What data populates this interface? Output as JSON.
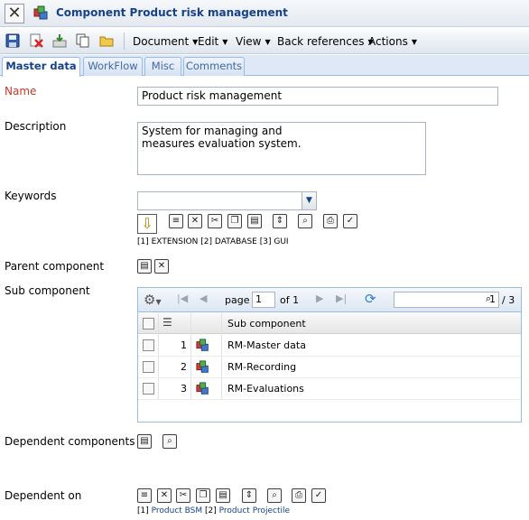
{
  "window": {
    "title": "Component Product risk management",
    "close_label": "✕"
  },
  "toolbar": {
    "menus": [
      "Document",
      "Edit",
      "View",
      "Back references",
      "Actions"
    ]
  },
  "tabs": [
    "Master data",
    "WorkFlow",
    "Misc",
    "Comments"
  ],
  "form": {
    "name_label": "Name",
    "name_value": "Product risk management",
    "description_label": "Description",
    "description_value": "System for managing and\nmeasures evaluation system.",
    "keywords_label": "Keywords",
    "keywords_value": "",
    "keywords_caption": {
      "i1": "[1]",
      "v1": "EXTENSION",
      "i2": "[2]",
      "v2": "DATABASE",
      "i3": "[3]",
      "v3": "GUI"
    },
    "parent_label": "Parent component",
    "sub_label": "Sub component",
    "dependent_components_label": "Dependent components",
    "dependent_on_label": "Dependent on",
    "dependent_on_caption": {
      "i1": "[1]",
      "v1": "Product BSM",
      "i2": "[2]",
      "v2": "Product Projectile"
    }
  },
  "grid": {
    "page_label": "page",
    "page_value": "1",
    "of_label": "of 1",
    "search_value": "1",
    "count_label": "/ 3",
    "column_header": "Sub component",
    "rows": [
      {
        "num": "1",
        "name": "RM-Master data"
      },
      {
        "num": "2",
        "name": "RM-Recording"
      },
      {
        "num": "3",
        "name": "RM-Evaluations"
      }
    ]
  },
  "colors": {
    "title": "#15428b",
    "required_label": "#c0392b",
    "link": "#15428b",
    "tab_border": "#99bbe8"
  },
  "icons": {
    "component_icon": "component-cubes-icon",
    "save": "save-icon",
    "delete": "delete-icon",
    "import": "import-icon",
    "copy": "copy-icon",
    "folder": "folder-icon"
  }
}
